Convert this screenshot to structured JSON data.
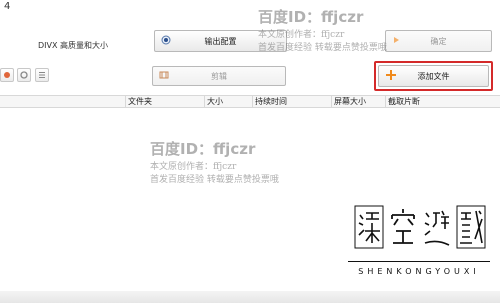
{
  "window": {
    "number_fragment": "4"
  },
  "profile": {
    "text": "DIVX 高质量和大小"
  },
  "buttons": {
    "output_config": "输出配置",
    "ok": "确定",
    "cut": "剪辑",
    "add_file": "添加文件"
  },
  "grid": {
    "columns": [
      "文件夹",
      "大小",
      "持续时间",
      "屏幕大小",
      "截取片断"
    ]
  },
  "watermark": {
    "id_label": "百度ID：ffjczr",
    "line1": "本文原创作者：ffjczr",
    "line2": "首发百度经验 转载要点赞投票哦"
  },
  "logo": {
    "chars": [
      "深",
      "空",
      "游",
      "戏"
    ],
    "text": "SHENKONGYOUXI"
  },
  "colors": {
    "highlight": "#d42a2a",
    "accent_orange": "#f08a1c"
  }
}
